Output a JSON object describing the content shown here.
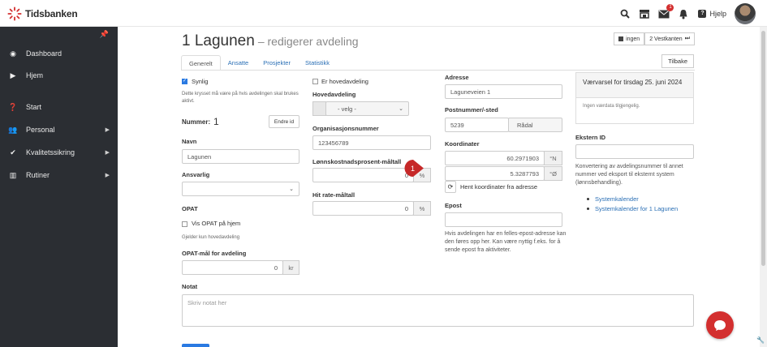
{
  "header": {
    "logo_text": "Tidsbanken",
    "notifications_count": "1",
    "help_label": "Hjelp"
  },
  "sidebar": {
    "items": [
      {
        "label": "Dashboard",
        "icon": "dashboard-icon"
      },
      {
        "label": "Hjem",
        "icon": "play-icon"
      },
      {
        "label": "Start",
        "icon": "question-icon"
      },
      {
        "label": "Personal",
        "icon": "users-icon"
      },
      {
        "label": "Kvalitetssikring",
        "icon": "check-icon"
      },
      {
        "label": "Rutiner",
        "icon": "chart-icon"
      }
    ]
  },
  "page": {
    "title": "1 Lagunen",
    "subtitle": "– redigerer avdeling",
    "btn_ingen": "ingen",
    "btn_vestkanten": "2 Vestkanten",
    "back": "Tilbake",
    "tabs": [
      "Generelt",
      "Ansatte",
      "Prosjekter",
      "Statistikk"
    ]
  },
  "form": {
    "synlig_label": "Synlig",
    "synlig_help": "Dette krysset må være på hvis avdelingen skal brukes aktivt.",
    "nummer_label": "Nummer:",
    "nummer_value": "1",
    "endre_id": "Endre id",
    "navn_label": "Navn",
    "navn_value": "Lagunen",
    "ansvarlig_label": "Ansvarlig",
    "opat_label": "OPAT",
    "vis_opat_label": "Vis OPAT på hjem",
    "opat_help": "Gjelder kun hovedavdeling",
    "opat_mal_label": "OPAT-mål for avdeling",
    "opat_mal_value": "0",
    "opat_mal_unit": "kr",
    "er_hovedavdeling_label": "Er hovedavdeling",
    "hovedavdeling_label": "Hovedavdeling",
    "hovedavdeling_value": "- velg -",
    "orgnr_label": "Organisasjonsnummer",
    "orgnr_value": "123456789",
    "marker_number": "1",
    "lonn_label": "Lønnskostnadsprosent-måltall",
    "lonn_value": "0",
    "lonn_unit": "%",
    "hitrate_label": "Hit rate-måltall",
    "hitrate_value": "0",
    "hitrate_unit": "%",
    "adresse_label": "Adresse",
    "adresse_value": "Laguneveien 1",
    "postnr_label": "Postnummer/-sted",
    "postnr_value": "5239",
    "poststed_value": "Rådal",
    "koord_label": "Koordinater",
    "koord_n": "60.2971903",
    "koord_n_unit": "°N",
    "koord_o": "5.3287793",
    "koord_o_unit": "°Ø",
    "hent_koord": "Hent koordinater fra adresse",
    "epost_label": "Epost",
    "epost_help": "Hvis avdelingen har en felles-epost-adresse kan den føres opp her. Kan være nyttig f.eks. for å sende epost fra aktiviteter.",
    "notat_label": "Notat",
    "notat_placeholder": "Skriv notat her"
  },
  "right": {
    "weather_title": "Værvarsel for tirsdag 25. juni 2024",
    "weather_body": "Ingen værdata tilgjengelig.",
    "ekstern_label": "Ekstern ID",
    "ekstern_help": "Konvertering av avdelingsnummer til annet nummer ved eksport til eksternt system (lønnsbehandling).",
    "links": [
      "Systemkalender",
      "Systemkalender for 1 Lagunen"
    ]
  }
}
